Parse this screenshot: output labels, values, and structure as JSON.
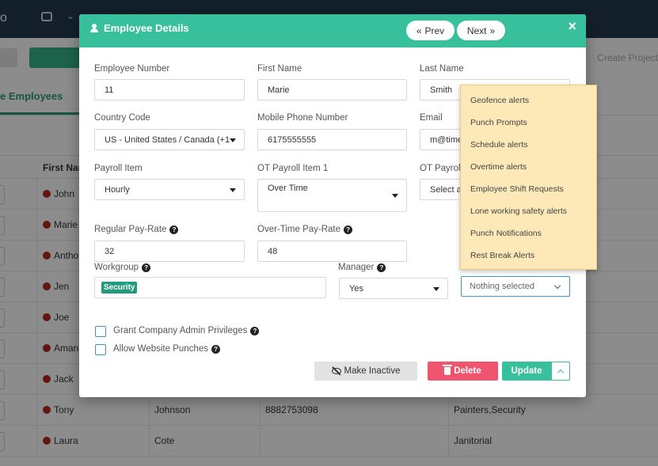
{
  "background": {
    "topbar_text": "o",
    "create_project": "Create Project",
    "active_tab": "e Employees",
    "table_header_first_name": "First Nam",
    "rows": [
      {
        "first": "John",
        "last": "",
        "phone": "",
        "workgroup": ""
      },
      {
        "first": "Marie",
        "last": "",
        "phone": "",
        "workgroup": ""
      },
      {
        "first": "Anthon",
        "last": "",
        "phone": "",
        "workgroup": ""
      },
      {
        "first": "Jen",
        "last": "",
        "phone": "",
        "workgroup": ""
      },
      {
        "first": "Joe",
        "last": "",
        "phone": "",
        "workgroup": ""
      },
      {
        "first": "Aman",
        "last": "",
        "phone": "",
        "workgroup": ""
      },
      {
        "first": "Jack",
        "last": "",
        "phone": "",
        "workgroup": ""
      },
      {
        "first": "Tony",
        "last": "Johnson",
        "phone": "8882753098",
        "workgroup": "Painters,Security"
      },
      {
        "first": "Laura",
        "last": "Cote",
        "phone": "",
        "workgroup": "Janitorial"
      }
    ]
  },
  "modal": {
    "title": "Employee Details",
    "prev_label": "Prev",
    "next_label": "Next",
    "close": "×",
    "fields": {
      "employee_number": {
        "label": "Employee Number",
        "value": "11"
      },
      "first_name": {
        "label": "First Name",
        "value": "Marie"
      },
      "last_name": {
        "label": "Last Name",
        "value": "Smith"
      },
      "country_code": {
        "label": "Country Code",
        "value": "US - United States / Canada (+1"
      },
      "mobile_phone": {
        "label": "Mobile Phone Number",
        "value": "6175555555"
      },
      "email": {
        "label": "Email",
        "value": "m@times"
      },
      "payroll_item": {
        "label": "Payroll Item",
        "value": "Hourly"
      },
      "ot_payroll_item_1": {
        "label": "OT Payroll Item 1",
        "value": "Over Time"
      },
      "ot_payroll_item_2": {
        "label": "OT Payroll",
        "value": "Select a"
      },
      "regular_pay_rate": {
        "label": "Regular Pay-Rate",
        "value": "32"
      },
      "overtime_pay_rate": {
        "label": "Over-Time Pay-Rate",
        "value": "48"
      },
      "workgroup": {
        "label": "Workgroup",
        "tag": "Security"
      },
      "manager": {
        "label": "Manager",
        "value": "Yes"
      },
      "alerts": {
        "value": "Nothing selected"
      }
    },
    "checkboxes": {
      "grant_admin": "Grant Company Admin Privileges",
      "allow_punches": "Allow Website Punches"
    },
    "buttons": {
      "make_inactive": "Make Inactive",
      "delete": "Delete",
      "update": "Update"
    }
  },
  "alerts_dropdown": [
    "Geofence alerts",
    "Punch Prompts",
    "Schedule alerts",
    "Overtime alerts",
    "Employee Shift Requests",
    "Lone working safety alerts",
    "Punch Notifications",
    "Rest Break Alerts"
  ],
  "colors": {
    "header_green": "#38bf9c",
    "delete_pink": "#f0556f",
    "dropdown_bg": "#fde9b7"
  }
}
